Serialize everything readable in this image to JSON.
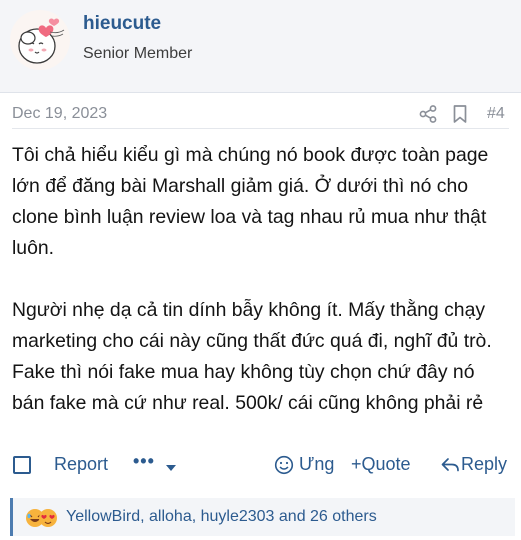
{
  "user": {
    "username": "hieucute",
    "title": "Senior Member"
  },
  "post": {
    "date": "Dec 19, 2023",
    "number": "#4",
    "paragraphs": [
      "Tôi chả hiểu kiểu gì mà chúng nó book được toàn page lớn để đăng bài Marshall giảm giá. Ở dưới thì nó cho clone bình luận review loa và tag nhau rủ mua như thật luôn.",
      "Người nhẹ dạ cả tin dính bẫy không ít. Mấy thằng chạy marketing cho cái này cũng thất đức quá đi, nghĩ đủ trò. Fake thì nói fake mua hay không tùy chọn chứ đây nó bán fake mà cứ như real. 500k/ cái cũng không phải rẻ"
    ]
  },
  "actions": {
    "report": "Report",
    "more": "•••",
    "react": "Ưng",
    "quote": "+Quote",
    "reply": "Reply"
  },
  "reactions": {
    "summary": "YellowBird, alloha, huyle2303 and 26 others",
    "icons": [
      "laugh-emoji-icon",
      "heart-emoji-icon"
    ]
  },
  "colors": {
    "link": "#2c5b8f",
    "muted": "#8a8f98",
    "header_bg": "#f4f5f8",
    "accent_border": "#4d7cb0"
  }
}
